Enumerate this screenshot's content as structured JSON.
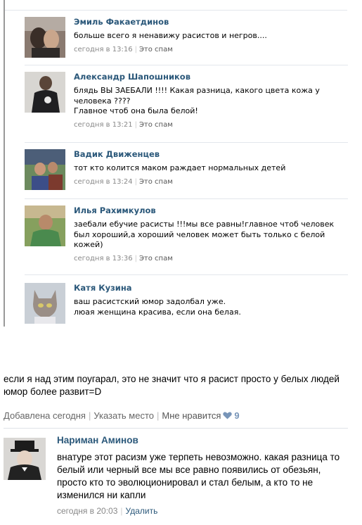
{
  "comments": [
    {
      "author": "Эмиль Факаетдинов",
      "text": "больше всего я ненавижу расистов и негров....",
      "time": "сегодня в 13:16",
      "action": "Это спам"
    },
    {
      "author": "Александр Шапошников",
      "text": "блядь ВЫ ЗАЕБАЛИ !!!! Какая разница, какого цвета кожа у человека ????\nГлавное чтоб она была белой!",
      "time": "сегодня в 13:21",
      "action": "Это спам"
    },
    {
      "author": "Вадик Движенцев",
      "text": "тот кто колится маком раждает нормальных детей",
      "time": "сегодня в 13:24",
      "action": "Это спам"
    },
    {
      "author": "Илья Рахимкулов",
      "text": "заебали ебучие расисты !!!мы все равны!главное чтоб человек был хороший,а хороший человек может быть только с белой кожей)",
      "time": "сегодня в 13:36",
      "action": "Это спам"
    },
    {
      "author": "Катя Кузина",
      "text": "ваш расистский юмор задолбал уже.\nлюая женщина красива, если она белая."
    }
  ],
  "post": {
    "text": "если я над этим поугарал, это не значит что я расист просто у белых людей юмор более развит=D",
    "added": "Добавлена сегодня",
    "place": "Указать место",
    "like": "Мне нравится",
    "like_count": "9"
  },
  "reply": {
    "author": "Нариман Аминов",
    "text": "внатуре этот расизм уже терпеть невозможно. какая разница то белый или черный все мы все равно появились от обезьян, просто кто то эволюционировал и стал белым, а кто то не изменился ни капли",
    "time": "сегодня в 20:03",
    "delete": "Удалить"
  },
  "colors": {
    "link": "#2b587a",
    "meta": "#888888",
    "like_count": "#7895b8"
  }
}
